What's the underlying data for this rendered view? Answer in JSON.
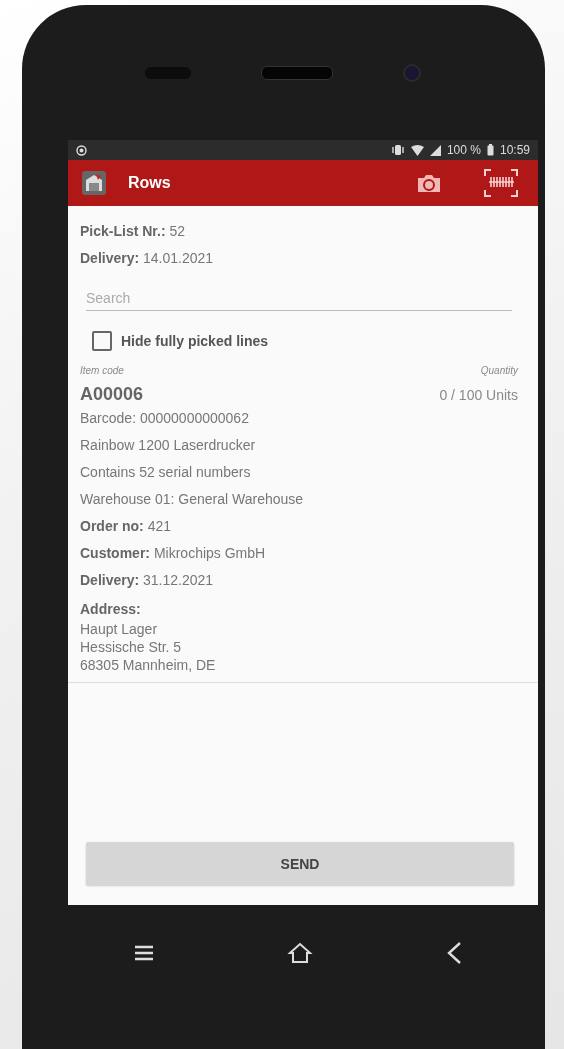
{
  "status_bar": {
    "battery": "100 %",
    "time": "10:59"
  },
  "app_bar": {
    "title": "Rows"
  },
  "header": [
    "**Pick-List Nr.:** 52",
    "**Delivery:** 14.01.2021"
  ],
  "search": {
    "placeholder": "Search"
  },
  "hide_picked": {
    "label": "Hide fully picked lines",
    "checked": false
  },
  "list_header": {
    "item_code": "Item code",
    "quantity": "Quantity"
  },
  "rows": [
    {
      "code": "A00006",
      "quantity": "0 / 100 Units",
      "details": [
        "Barcode: 00000000000062",
        "Rainbow 1200 Laserdrucker",
        "Contains 52 serial numbers",
        "Warehouse 01: General Warehouse",
        "**Order no:** 421",
        "**Customer:** Mikrochips GmbH",
        "**Delivery:** 31.12.2021"
      ],
      "address_label": "Address:",
      "address": [
        "Haupt Lager",
        "Hessische Str. 5",
        "68305 Mannheim, DE"
      ]
    }
  ],
  "send_button": "SEND"
}
